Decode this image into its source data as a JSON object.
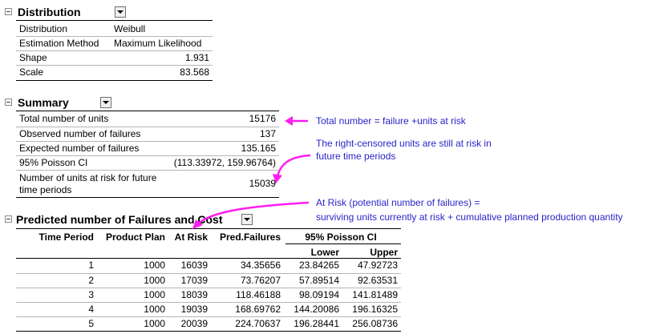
{
  "distribution": {
    "title": "Distribution",
    "rows": [
      {
        "label": "Distribution",
        "value": "Weibull"
      },
      {
        "label": "Estimation Method",
        "value": "Maximum Likelihood"
      },
      {
        "label": "Shape",
        "value": "1.931"
      },
      {
        "label": "Scale",
        "value": "83.568"
      }
    ]
  },
  "summary": {
    "title": "Summary",
    "rows": [
      {
        "label": "Total number of units",
        "value": "15176"
      },
      {
        "label": "Observed number of failures",
        "value": "137"
      },
      {
        "label": "Expected number of failures",
        "value": "135.165"
      },
      {
        "label": "95% Poisson CI",
        "value": "(113.33972, 159.96764)"
      },
      {
        "label_line1": "Number of units at risk for future",
        "label_line2": "time periods",
        "value": "15039"
      }
    ]
  },
  "predicted": {
    "title": "Predicted number of Failures and Cost",
    "headers": {
      "time_period": "Time Period",
      "product_plan": "Product Plan",
      "at_risk": "At Risk",
      "pred_failures": "Pred.Failures",
      "ci": "95% Poisson CI",
      "lower": "Lower",
      "upper": "Upper"
    },
    "rows": [
      [
        "1",
        "1000",
        "16039",
        "34.35656",
        "23.84265",
        "47.92723"
      ],
      [
        "2",
        "1000",
        "17039",
        "73.76207",
        "57.89514",
        "92.63531"
      ],
      [
        "3",
        "1000",
        "18039",
        "118.46188",
        "98.09194",
        "141.81489"
      ],
      [
        "4",
        "1000",
        "19039",
        "168.69762",
        "144.20086",
        "196.16325"
      ],
      [
        "5",
        "1000",
        "20039",
        "224.70637",
        "196.28441",
        "256.08736"
      ]
    ]
  },
  "annotations": {
    "total_note": "Total number = failure +units at risk",
    "censored_note_line1": "The right-censored units are still at risk in",
    "censored_note_line2": "future time periods",
    "atrisk_note_line1": "At Risk (potential number of failures) =",
    "atrisk_note_line2": "surviving units currently at risk + cumulative planned production quantity",
    "note_color": "#2a24c8",
    "arrow_color": "#ff1cf0"
  }
}
